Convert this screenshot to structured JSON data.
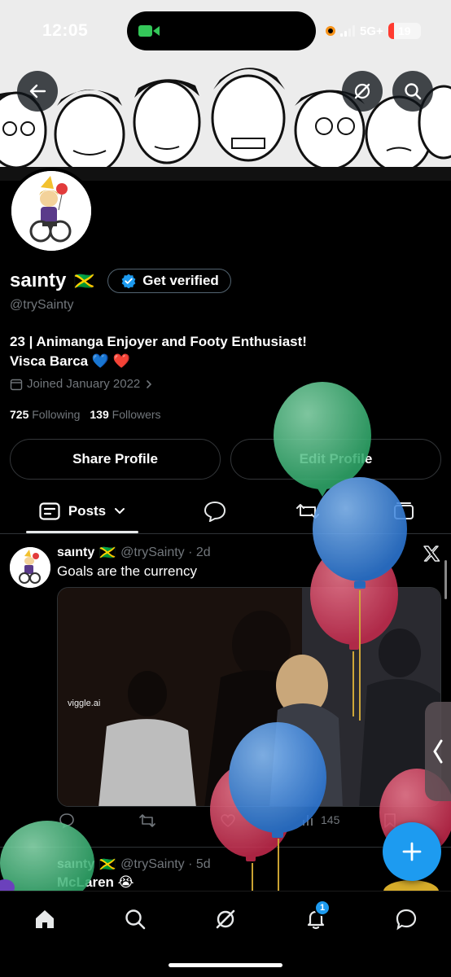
{
  "status_bar": {
    "time": "12:05",
    "network": "5G+",
    "battery": "19",
    "battery_level_fraction": 0.19
  },
  "banner": {
    "description_icon": "manga-banner-image"
  },
  "profile": {
    "display_name": "saınty",
    "flag": "🇯🇲",
    "get_verified_label": "Get verified",
    "handle": "@trySainty",
    "bio_line1": "23 | Animanga Enjoyer and Footy Enthusiast!",
    "bio_line2": "Visca Barca 💙 ❤️",
    "joined": "Joined January 2022",
    "following_count": "725",
    "following_label": "Following",
    "followers_count": "139",
    "followers_label": "Followers",
    "share_button": "Share Profile",
    "edit_button": "Edit Profile"
  },
  "tabs": {
    "posts_label": "Posts"
  },
  "tweets": [
    {
      "name": "saınty",
      "flag": "🇯🇲",
      "handle_time": "@trySainty · 2d",
      "text": "Goals are the currency",
      "media_watermark": "viggle.ai",
      "views": "145"
    },
    {
      "name": "saınty",
      "flag": "🇯🇲",
      "handle_time": "@trySainty · 5d",
      "text": "McLaren 😭"
    }
  ],
  "bottom_nav": {
    "notifications_badge": "1"
  },
  "colors": {
    "accent": "#1d9bf0",
    "balloon_green": "#3dbd7d",
    "balloon_blue": "#3d8fe0",
    "balloon_red": "#d23a5a"
  }
}
